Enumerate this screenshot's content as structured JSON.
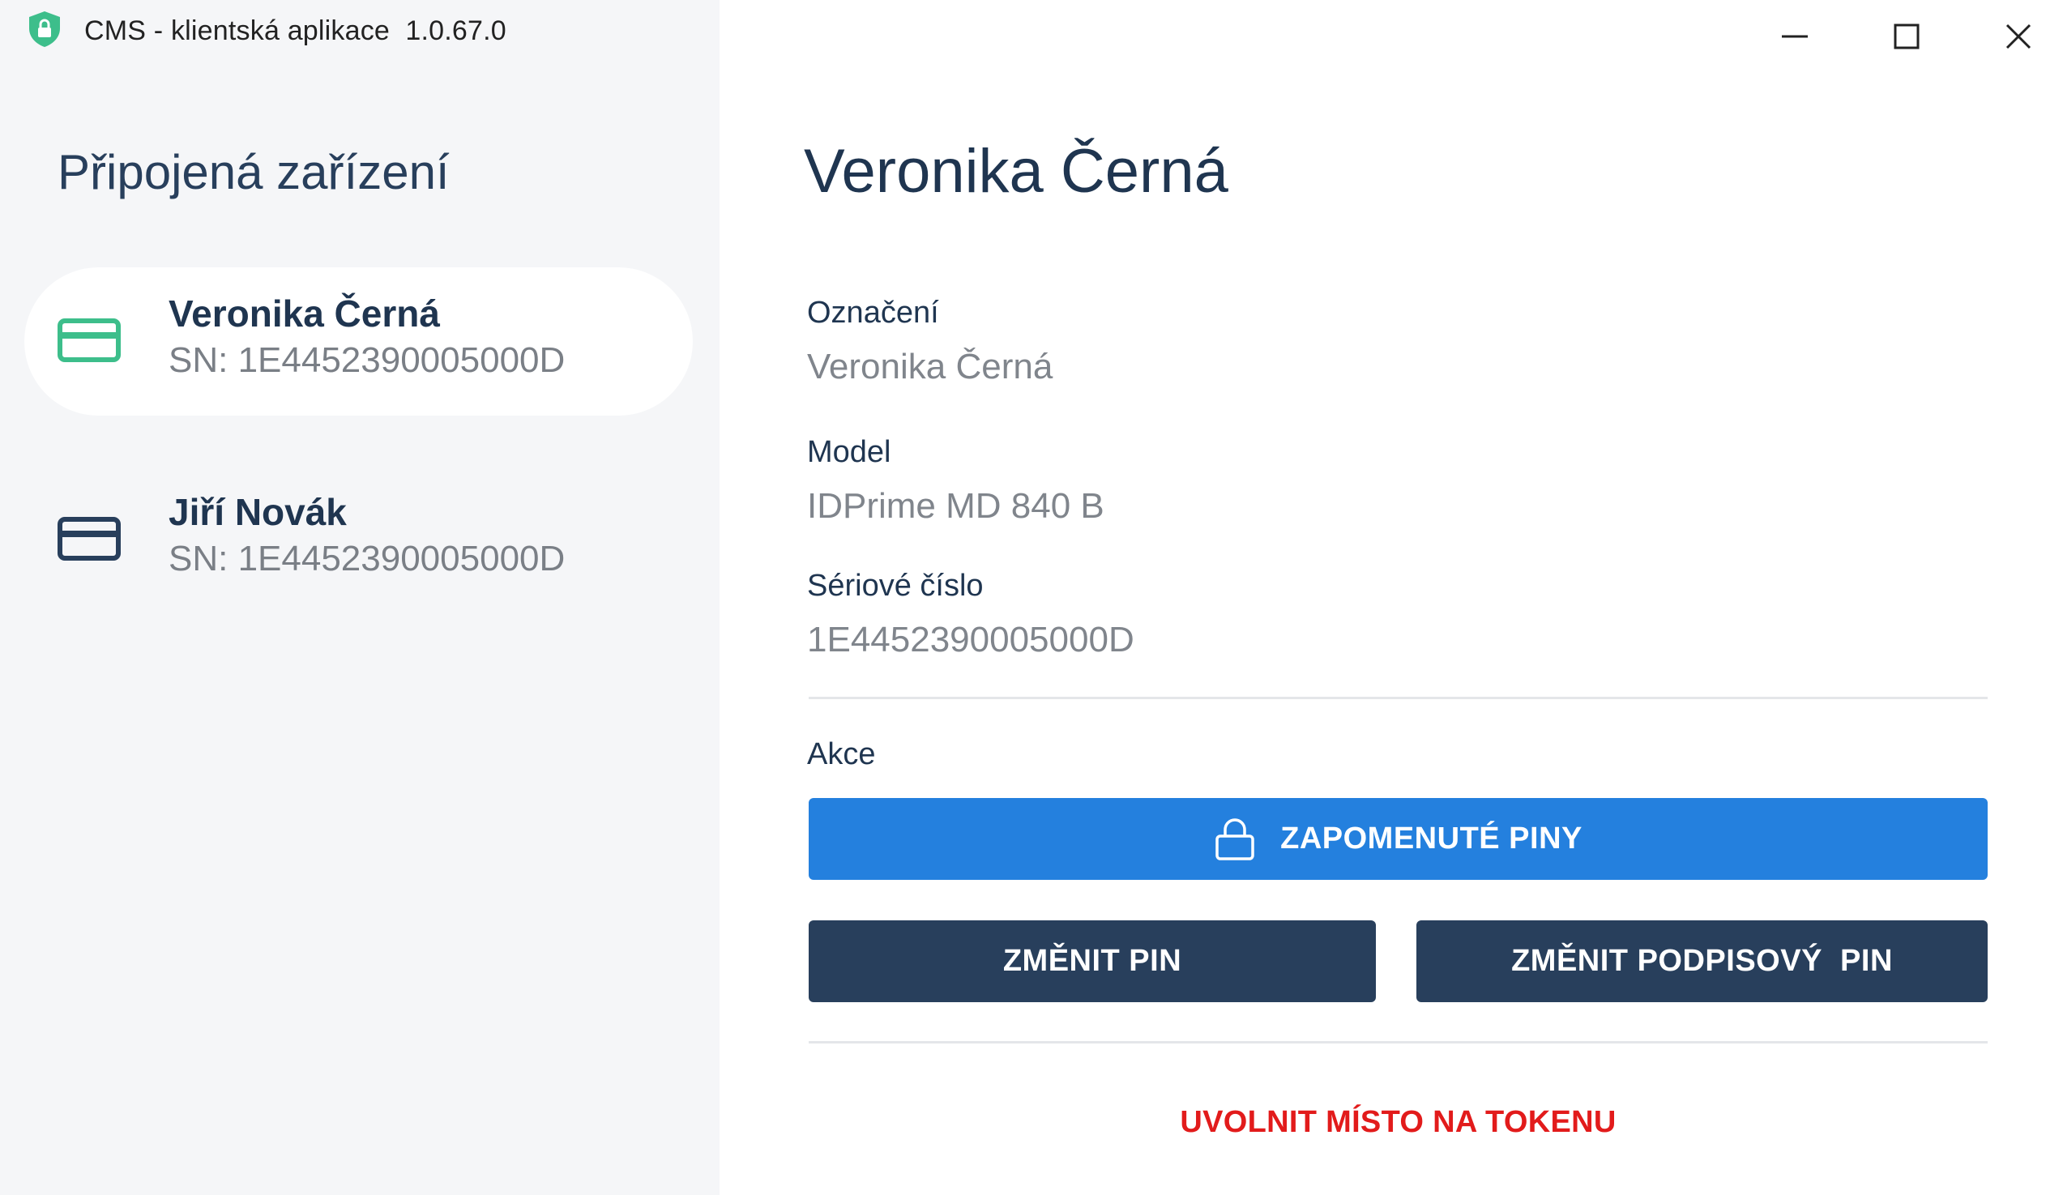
{
  "app": {
    "title": "CMS - klientská aplikace",
    "version": "1.0.67.0",
    "icon": "shield-lock-icon"
  },
  "window_controls": {
    "minimize_icon": "minimize-icon",
    "maximize_icon": "maximize-icon",
    "close_icon": "close-icon"
  },
  "sidebar": {
    "heading": "Připojená zařízení",
    "devices": [
      {
        "name": "Veronika Černá",
        "sn": "SN: 1E4452390005000D",
        "icon": "credit-card-icon",
        "selected": true,
        "icon_color": "#3dbe8b"
      },
      {
        "name": "Jiří Novák",
        "sn": "SN: 1E4452390005000D",
        "icon": "credit-card-icon",
        "selected": false,
        "icon_color": "#283f5c"
      }
    ]
  },
  "detail": {
    "title": "Veronika Černá",
    "fields": [
      {
        "label": "Označení",
        "value": "Veronika Černá"
      },
      {
        "label": "Model",
        "value": "IDPrime MD 840 B"
      },
      {
        "label": "Sériové číslo",
        "value": "1E4452390005000D"
      }
    ],
    "actions_label": "Akce",
    "forgot_pins_label": "ZAPOMENUTÉ PINY",
    "forgot_pins_icon": "lock-icon",
    "change_pin_label": "ZMĚNIT PIN",
    "change_sign_pin_label": "ZMĚNIT PODPISOVÝ  PIN",
    "free_space_label": "UVOLNIT MÍSTO NA TOKENU"
  },
  "colors": {
    "primary": "#2480de",
    "dark": "#283f5c",
    "danger": "#e21b1b",
    "accent_green": "#3dbe8b",
    "sidebar_bg": "#f5f6f8"
  }
}
